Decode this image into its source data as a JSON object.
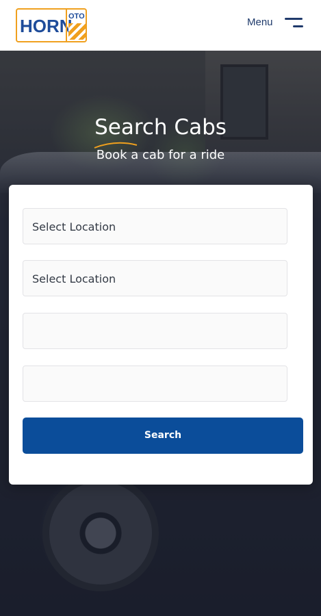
{
  "header": {
    "logo_main": "HORN",
    "logo_sub": "OTO",
    "menu_label": "Menu"
  },
  "hero": {
    "title": "Search Cabs",
    "subtitle": "Book a cab for a ride"
  },
  "form": {
    "pickup_location": "Select Location",
    "drop_location": "Select Location",
    "field_3_value": "",
    "field_4_value": "",
    "search_label": "Search"
  },
  "colors": {
    "brand_blue": "#0b4d9a",
    "logo_orange": "#f0a01e",
    "accent_underline": "#f0a01e"
  },
  "icons": {
    "menu": "hamburger-icon"
  }
}
